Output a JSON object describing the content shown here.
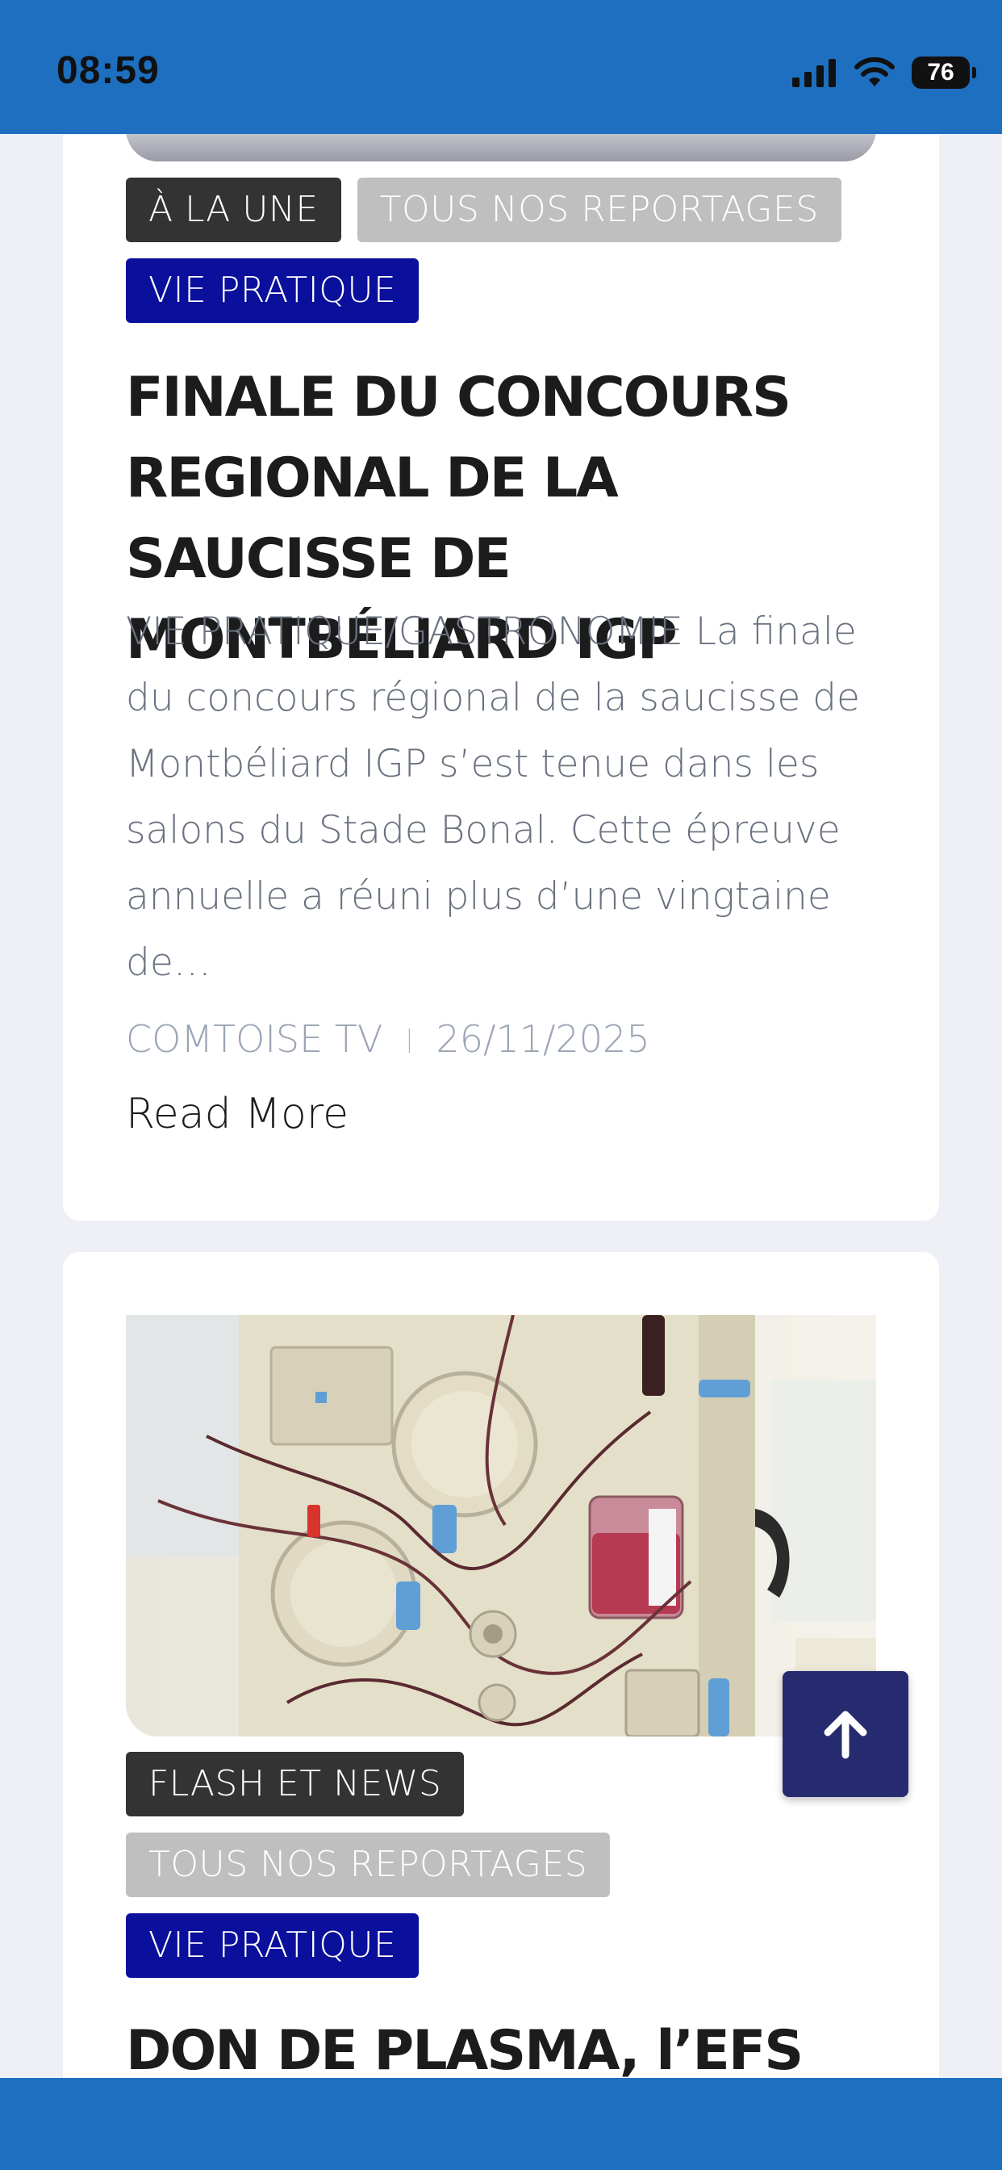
{
  "status_bar": {
    "time": "08:59",
    "battery": "76"
  },
  "articles": [
    {
      "tags": [
        "À LA UNE",
        "TOUS NOS REPORTAGES",
        "VIE PRATIQUE"
      ],
      "title": "FINALE DU CONCOURS REGIONAL DE LA SAUCISSE DE MONTBÉLIARD IGP",
      "excerpt": "VIE PRATIQUE/GASTRONOMIE La finale du concours régional de la saucisse de Montbéliard IGP s’est tenue dans les salons du Stade Bonal. Cette épreuve annuelle a réuni plus d’une vingtaine de…",
      "author": "COMTOISE TV",
      "separator": "|",
      "date": "26/11/2025",
      "read_more": "Read More"
    },
    {
      "tags": [
        "FLASH ET NEWS",
        "TOUS NOS REPORTAGES",
        "VIE PRATIQUE"
      ],
      "title": "DON DE PLASMA, l’EFS"
    }
  ],
  "colors": {
    "status_bar": "#1e6fbf",
    "tag_dark": "#333333",
    "tag_grey": "#bfbfbf",
    "tag_blue": "#0a0f9c",
    "scroll_button": "#262a6e"
  },
  "icons": {
    "signal": "signal-icon",
    "wifi": "wifi-icon",
    "battery": "battery-icon",
    "scroll_top": "arrow-up-icon"
  }
}
